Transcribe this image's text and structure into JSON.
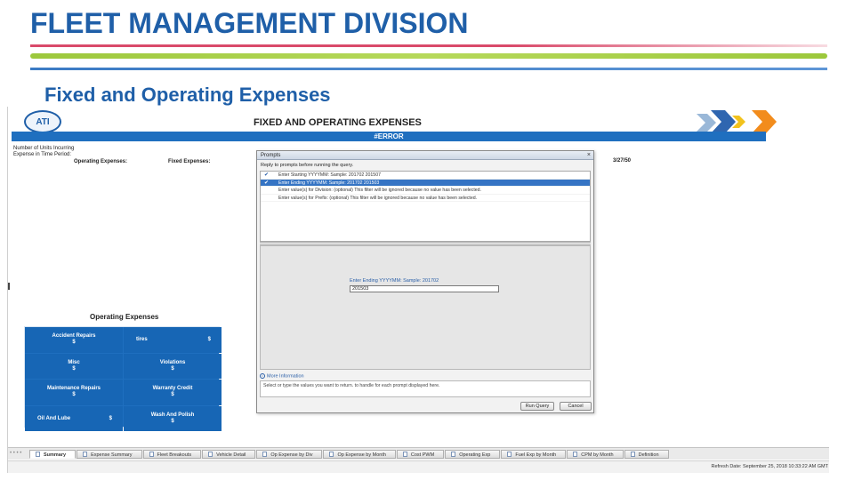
{
  "slide": {
    "title": "FLEET MANAGEMENT DIVISION",
    "subtitle": "Fixed and Operating Expenses"
  },
  "report": {
    "logo_text": "ATI",
    "title": "FIXED AND OPERATING EXPENSES",
    "error_text": "#ERROR",
    "units_label": "Number of Units Incurring Expense in Time Period:",
    "operating_expenses_label": "Operating Expenses:",
    "fixed_expenses_label": "Fixed Expenses:",
    "date_fragment": "3/27/50",
    "grid_title": "Operating Expenses",
    "grid": [
      {
        "name": "Accident Repairs",
        "dollar": "$"
      },
      {
        "name": "tires",
        "dollar": "$"
      },
      {
        "name": "Misc",
        "dollar": "$"
      },
      {
        "name": "Violations",
        "dollar": "$"
      },
      {
        "name": "Maintenance Repairs",
        "dollar": "$"
      },
      {
        "name": "Warranty Credit",
        "dollar": "$"
      },
      {
        "name": "Oil And Lube",
        "dollar": "$"
      },
      {
        "name": "Wash And Polish",
        "dollar": "$"
      }
    ]
  },
  "dialog": {
    "title": "Prompts",
    "close": "×",
    "instruction": "Reply to prompts before running the query.",
    "prompts": [
      {
        "text": "Enter Starting YYYYMM:  Sample: 201702 201507",
        "checked": true,
        "selected": false
      },
      {
        "text": "Enter Ending YYYYMM: Sample: 201702 201503",
        "checked": true,
        "selected": true
      },
      {
        "text": "Enter value(s) for Division: (optional)  This filter will be ignored because no value has been selected.",
        "checked": false,
        "selected": false
      },
      {
        "text": "Enter value(s) for Prefix: (optional)  This filter will be ignored because no value has been selected.",
        "checked": false,
        "selected": false
      }
    ],
    "enter_label": "Enter Ending YYYYMM:  Sample: 201702",
    "enter_value": "201503",
    "info_head": "More Information",
    "info_text": "Select or type the values you want to return. to handle for each prompt displayed here.",
    "run_button": "Run Query",
    "cancel_button": "Cancel"
  },
  "tabs": {
    "dots": "• • • •",
    "items": [
      "Summary",
      "Expense Summary",
      "Fleet Breakouts",
      "Vehicle Detail",
      "Op Expense by Div",
      "Op Expense by Month",
      "Cost PWM",
      "Operating Exp",
      "Fuel Exp by Month",
      "CPM by Month",
      "Definition"
    ]
  },
  "status": {
    "text": "Refresh Date: September 25, 2018 10:33:22 AM GMT"
  }
}
